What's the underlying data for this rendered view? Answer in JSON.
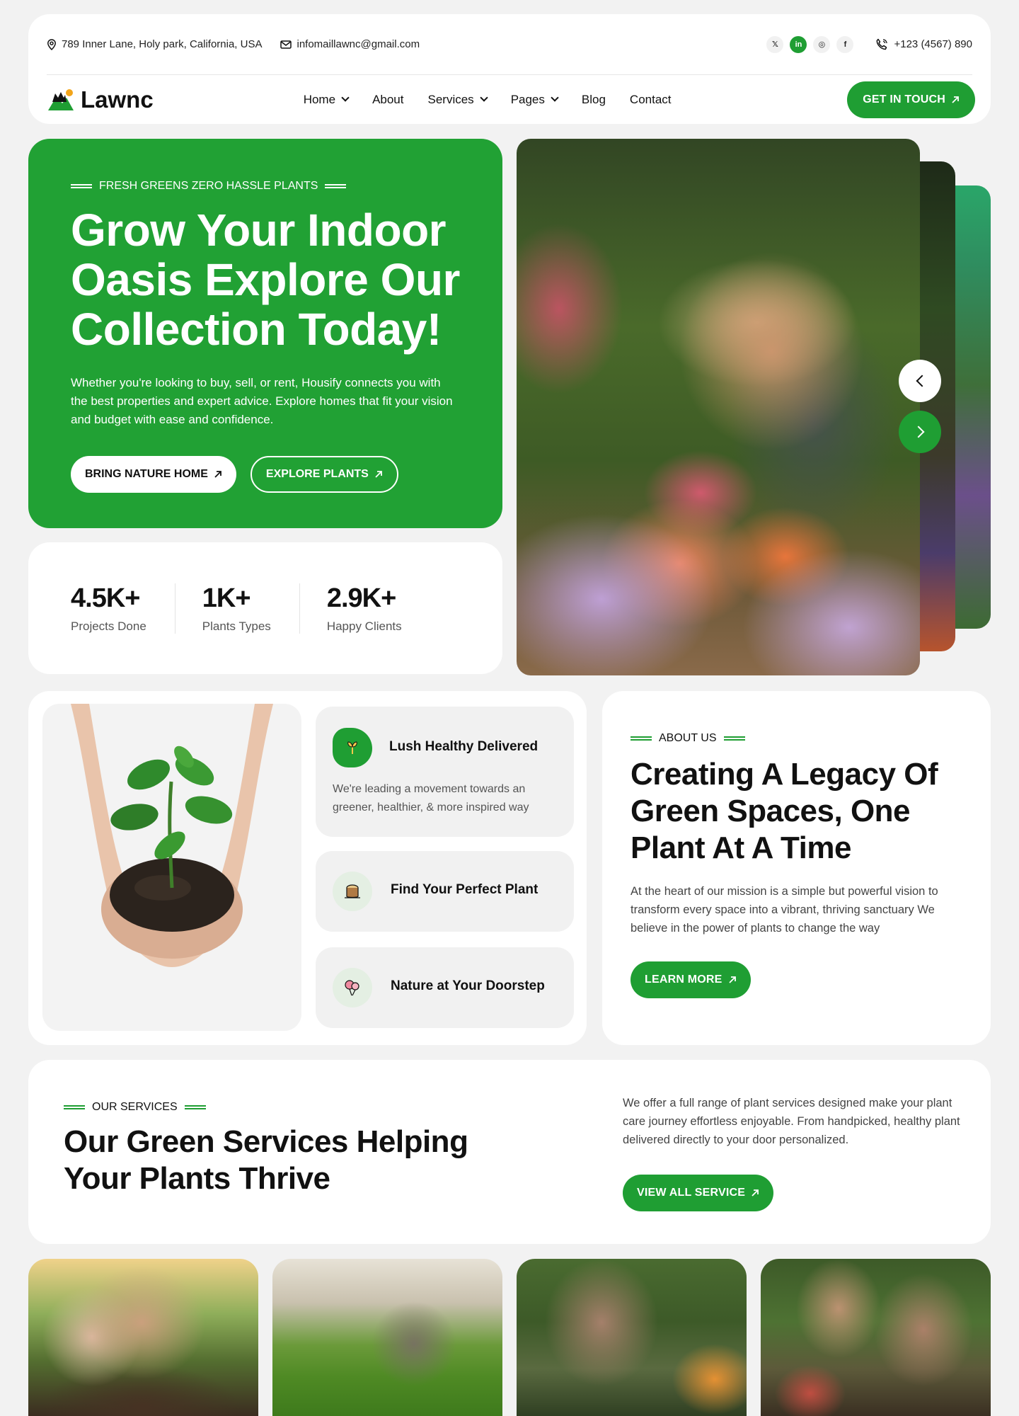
{
  "topbar": {
    "address": "789 Inner Lane, Holy park, California, USA",
    "email": "infomaillawnc@gmail.com",
    "social": [
      {
        "icon": "x-icon",
        "glyph": "𝕏"
      },
      {
        "icon": "linkedin-icon",
        "glyph": "in"
      },
      {
        "icon": "instagram-icon",
        "glyph": "◎"
      },
      {
        "icon": "facebook-icon",
        "glyph": "f"
      }
    ],
    "phone": "+123 (4567) 890"
  },
  "nav": {
    "logo": "Lawnc",
    "items": [
      {
        "label": "Home",
        "dropdown": true
      },
      {
        "label": "About",
        "dropdown": false
      },
      {
        "label": "Services",
        "dropdown": true
      },
      {
        "label": "Pages",
        "dropdown": true
      },
      {
        "label": "Blog",
        "dropdown": false
      },
      {
        "label": "Contact",
        "dropdown": false
      }
    ],
    "cta": "GET IN TOUCH"
  },
  "hero": {
    "eyebrow": "FRESH GREENS ZERO HASSLE PLANTS",
    "title_l1": "Grow Your Indoor",
    "title_l2": "Oasis Explore Our",
    "title_l3": "Collection Today!",
    "description": "Whether you're looking to buy, sell, or rent, Housify connects you with the best properties and expert advice. Explore homes that fit your vision and budget with ease and confidence.",
    "btn_primary": "BRING NATURE HOME",
    "btn_secondary": "EXPLORE PLANTS"
  },
  "stats": [
    {
      "value": "4.5K+",
      "label": "Projects Done"
    },
    {
      "value": "1K+",
      "label": "Plants Types"
    },
    {
      "value": "2.9K+",
      "label": "Happy Clients"
    }
  ],
  "features": [
    {
      "title": "Lush Healthy Delivered",
      "desc": "We're leading a movement towards an greener, healthier, & more inspired way",
      "icon": "plant-leaf-icon"
    },
    {
      "title": "Find Your Perfect Plant",
      "icon": "tree-stump-icon"
    },
    {
      "title": "Nature at Your Doorstep",
      "icon": "balloon-flower-icon"
    }
  ],
  "about": {
    "eyebrow": "ABOUT US",
    "title": "Creating A Legacy Of Green Spaces, One Plant At A Time",
    "description": "At the heart of our mission is a simple but powerful vision to transform every space into a vibrant, thriving sanctuary We believe in the power of plants to change the way",
    "cta": "LEARN MORE"
  },
  "services": {
    "eyebrow": "OUR SERVICES",
    "title_l1": "Our Green Services Helping",
    "title_l2": "Your Plants Thrive",
    "description": "We offer a full range of plant services designed make your plant care journey effortless enjoyable. From handpicked, healthy plant delivered directly to your door personalized.",
    "cta": "VIEW ALL SERVICE"
  },
  "colors": {
    "accent": "#1f9e33",
    "hero_bg": "#21a134",
    "page_bg": "#f2f2f2"
  }
}
